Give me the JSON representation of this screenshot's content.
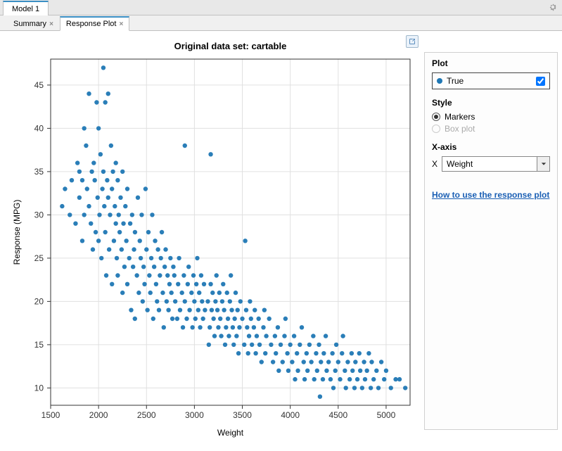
{
  "model_tab": {
    "label": "Model 1"
  },
  "inner_tabs": {
    "summary": "Summary",
    "response_plot": "Response Plot"
  },
  "sidebar": {
    "plot_section": "Plot",
    "legend_label": "True",
    "style_section": "Style",
    "style_markers": "Markers",
    "style_boxplot": "Box plot",
    "xaxis_section": "X-axis",
    "xaxis_prefix": "X",
    "xaxis_value": "Weight",
    "help_link": "How to use the response plot"
  },
  "chart": {
    "title": "Original data set: cartable",
    "xlabel": "Weight",
    "ylabel": "Response (MPG)",
    "xticks": [
      1500,
      2000,
      2500,
      3000,
      3500,
      4000,
      4500,
      5000
    ],
    "yticks": [
      10,
      15,
      20,
      25,
      30,
      35,
      40,
      45
    ]
  },
  "chart_data": {
    "type": "scatter",
    "title": "Original data set: cartable",
    "xlabel": "Weight",
    "ylabel": "Response (MPG)",
    "xlim": [
      1500,
      5250
    ],
    "ylim": [
      8,
      48
    ],
    "series": [
      {
        "name": "True",
        "points": [
          [
            1620,
            31
          ],
          [
            1650,
            33
          ],
          [
            1700,
            30
          ],
          [
            1720,
            34
          ],
          [
            1760,
            29
          ],
          [
            1780,
            36
          ],
          [
            1800,
            35
          ],
          [
            1800,
            32
          ],
          [
            1830,
            27
          ],
          [
            1830,
            34
          ],
          [
            1850,
            30
          ],
          [
            1850,
            40
          ],
          [
            1870,
            38
          ],
          [
            1880,
            33
          ],
          [
            1900,
            31
          ],
          [
            1900,
            44
          ],
          [
            1920,
            29
          ],
          [
            1930,
            35
          ],
          [
            1940,
            26
          ],
          [
            1950,
            36
          ],
          [
            1960,
            34
          ],
          [
            1970,
            28
          ],
          [
            1980,
            43
          ],
          [
            1990,
            32
          ],
          [
            2000,
            40
          ],
          [
            2000,
            27
          ],
          [
            2010,
            30
          ],
          [
            2020,
            37
          ],
          [
            2030,
            25
          ],
          [
            2040,
            33
          ],
          [
            2050,
            35
          ],
          [
            2050,
            47
          ],
          [
            2060,
            31
          ],
          [
            2070,
            28
          ],
          [
            2070,
            43
          ],
          [
            2080,
            23
          ],
          [
            2090,
            34
          ],
          [
            2100,
            32
          ],
          [
            2100,
            44
          ],
          [
            2110,
            26
          ],
          [
            2120,
            30
          ],
          [
            2130,
            38
          ],
          [
            2140,
            22
          ],
          [
            2140,
            33
          ],
          [
            2150,
            35
          ],
          [
            2160,
            27
          ],
          [
            2170,
            31
          ],
          [
            2180,
            29
          ],
          [
            2180,
            36
          ],
          [
            2190,
            25
          ],
          [
            2200,
            23
          ],
          [
            2200,
            34
          ],
          [
            2210,
            30
          ],
          [
            2220,
            28
          ],
          [
            2230,
            32
          ],
          [
            2240,
            26
          ],
          [
            2250,
            21
          ],
          [
            2250,
            35
          ],
          [
            2260,
            29
          ],
          [
            2270,
            24
          ],
          [
            2280,
            31
          ],
          [
            2290,
            27
          ],
          [
            2300,
            22
          ],
          [
            2300,
            33
          ],
          [
            2320,
            25
          ],
          [
            2330,
            29
          ],
          [
            2340,
            19
          ],
          [
            2350,
            30
          ],
          [
            2360,
            24
          ],
          [
            2370,
            26
          ],
          [
            2379,
            18
          ],
          [
            2380,
            28
          ],
          [
            2400,
            23
          ],
          [
            2410,
            32
          ],
          [
            2420,
            21
          ],
          [
            2430,
            27
          ],
          [
            2440,
            25
          ],
          [
            2450,
            30
          ],
          [
            2460,
            20
          ],
          [
            2470,
            24
          ],
          [
            2480,
            22
          ],
          [
            2490,
            33
          ],
          [
            2500,
            26
          ],
          [
            2510,
            19
          ],
          [
            2520,
            28
          ],
          [
            2530,
            23
          ],
          [
            2540,
            21
          ],
          [
            2550,
            25
          ],
          [
            2560,
            30
          ],
          [
            2570,
            18
          ],
          [
            2580,
            24
          ],
          [
            2590,
            27
          ],
          [
            2600,
            22
          ],
          [
            2610,
            20
          ],
          [
            2620,
            26
          ],
          [
            2630,
            19
          ],
          [
            2640,
            23
          ],
          [
            2650,
            25
          ],
          [
            2660,
            28
          ],
          [
            2670,
            21
          ],
          [
            2680,
            17
          ],
          [
            2690,
            24
          ],
          [
            2700,
            26
          ],
          [
            2710,
            20
          ],
          [
            2720,
            23
          ],
          [
            2730,
            19
          ],
          [
            2740,
            22
          ],
          [
            2750,
            25
          ],
          [
            2760,
            21
          ],
          [
            2770,
            18
          ],
          [
            2780,
            24
          ],
          [
            2790,
            23
          ],
          [
            2800,
            20
          ],
          [
            2820,
            18
          ],
          [
            2830,
            22
          ],
          [
            2840,
            25
          ],
          [
            2850,
            19
          ],
          [
            2870,
            21
          ],
          [
            2880,
            17
          ],
          [
            2890,
            23
          ],
          [
            2900,
            20
          ],
          [
            2900,
            38
          ],
          [
            2920,
            18
          ],
          [
            2930,
            22
          ],
          [
            2940,
            24
          ],
          [
            2950,
            19
          ],
          [
            2970,
            21
          ],
          [
            2980,
            17
          ],
          [
            2990,
            23
          ],
          [
            3000,
            20
          ],
          [
            3010,
            18
          ],
          [
            3020,
            22
          ],
          [
            3030,
            25
          ],
          [
            3040,
            19
          ],
          [
            3050,
            21
          ],
          [
            3060,
            17
          ],
          [
            3070,
            23
          ],
          [
            3080,
            20
          ],
          [
            3090,
            18
          ],
          [
            3100,
            22
          ],
          [
            3110,
            19
          ],
          [
            3140,
            20
          ],
          [
            3150,
            15
          ],
          [
            3160,
            17
          ],
          [
            3170,
            22
          ],
          [
            3170,
            37
          ],
          [
            3180,
            19
          ],
          [
            3190,
            21
          ],
          [
            3200,
            18
          ],
          [
            3210,
            16
          ],
          [
            3220,
            20
          ],
          [
            3230,
            23
          ],
          [
            3240,
            19
          ],
          [
            3250,
            17
          ],
          [
            3260,
            21
          ],
          [
            3270,
            18
          ],
          [
            3280,
            16
          ],
          [
            3290,
            20
          ],
          [
            3300,
            22
          ],
          [
            3310,
            19
          ],
          [
            3320,
            15
          ],
          [
            3330,
            17
          ],
          [
            3340,
            21
          ],
          [
            3350,
            18
          ],
          [
            3360,
            16
          ],
          [
            3370,
            20
          ],
          [
            3380,
            23
          ],
          [
            3390,
            19
          ],
          [
            3400,
            17
          ],
          [
            3410,
            15
          ],
          [
            3420,
            18
          ],
          [
            3430,
            21
          ],
          [
            3440,
            16
          ],
          [
            3450,
            19
          ],
          [
            3460,
            14
          ],
          [
            3470,
            17
          ],
          [
            3480,
            20
          ],
          [
            3500,
            18
          ],
          [
            3520,
            15
          ],
          [
            3530,
            27
          ],
          [
            3540,
            19
          ],
          [
            3550,
            17
          ],
          [
            3560,
            14
          ],
          [
            3570,
            16
          ],
          [
            3580,
            20
          ],
          [
            3590,
            18
          ],
          [
            3600,
            15
          ],
          [
            3620,
            17
          ],
          [
            3630,
            19
          ],
          [
            3640,
            14
          ],
          [
            3650,
            16
          ],
          [
            3670,
            18
          ],
          [
            3680,
            15
          ],
          [
            3700,
            13
          ],
          [
            3720,
            17
          ],
          [
            3730,
            19
          ],
          [
            3740,
            14
          ],
          [
            3750,
            16
          ],
          [
            3780,
            18
          ],
          [
            3800,
            15
          ],
          [
            3820,
            13
          ],
          [
            3840,
            16
          ],
          [
            3850,
            14
          ],
          [
            3870,
            17
          ],
          [
            3880,
            12
          ],
          [
            3900,
            15
          ],
          [
            3920,
            13
          ],
          [
            3940,
            16
          ],
          [
            3950,
            18
          ],
          [
            3970,
            14
          ],
          [
            3980,
            12
          ],
          [
            4000,
            15
          ],
          [
            4020,
            13
          ],
          [
            4040,
            16
          ],
          [
            4050,
            11
          ],
          [
            4070,
            14
          ],
          [
            4080,
            12
          ],
          [
            4100,
            15
          ],
          [
            4120,
            17
          ],
          [
            4140,
            13
          ],
          [
            4150,
            11
          ],
          [
            4170,
            14
          ],
          [
            4180,
            12
          ],
          [
            4200,
            15
          ],
          [
            4220,
            13
          ],
          [
            4240,
            16
          ],
          [
            4250,
            11
          ],
          [
            4270,
            14
          ],
          [
            4280,
            12
          ],
          [
            4300,
            15
          ],
          [
            4320,
            13
          ],
          [
            4310,
            9
          ],
          [
            4340,
            11
          ],
          [
            4350,
            14
          ],
          [
            4370,
            16
          ],
          [
            4380,
            12
          ],
          [
            4400,
            13
          ],
          [
            4420,
            11
          ],
          [
            4440,
            14
          ],
          [
            4450,
            10
          ],
          [
            4470,
            12
          ],
          [
            4480,
            15
          ],
          [
            4500,
            13
          ],
          [
            4520,
            11
          ],
          [
            4540,
            14
          ],
          [
            4550,
            16
          ],
          [
            4570,
            12
          ],
          [
            4580,
            10
          ],
          [
            4600,
            13
          ],
          [
            4620,
            11
          ],
          [
            4640,
            14
          ],
          [
            4650,
            12
          ],
          [
            4670,
            10
          ],
          [
            4680,
            13
          ],
          [
            4700,
            11
          ],
          [
            4720,
            14
          ],
          [
            4730,
            12
          ],
          [
            4750,
            10
          ],
          [
            4770,
            13
          ],
          [
            4780,
            11
          ],
          [
            4800,
            12
          ],
          [
            4820,
            14
          ],
          [
            4840,
            10
          ],
          [
            4850,
            13
          ],
          [
            4870,
            11
          ],
          [
            4900,
            12
          ],
          [
            4920,
            10
          ],
          [
            4950,
            13
          ],
          [
            4980,
            11
          ],
          [
            5000,
            12
          ],
          [
            5050,
            10
          ],
          [
            5100,
            11
          ],
          [
            5140,
            11
          ],
          [
            5200,
            10
          ]
        ]
      }
    ]
  }
}
